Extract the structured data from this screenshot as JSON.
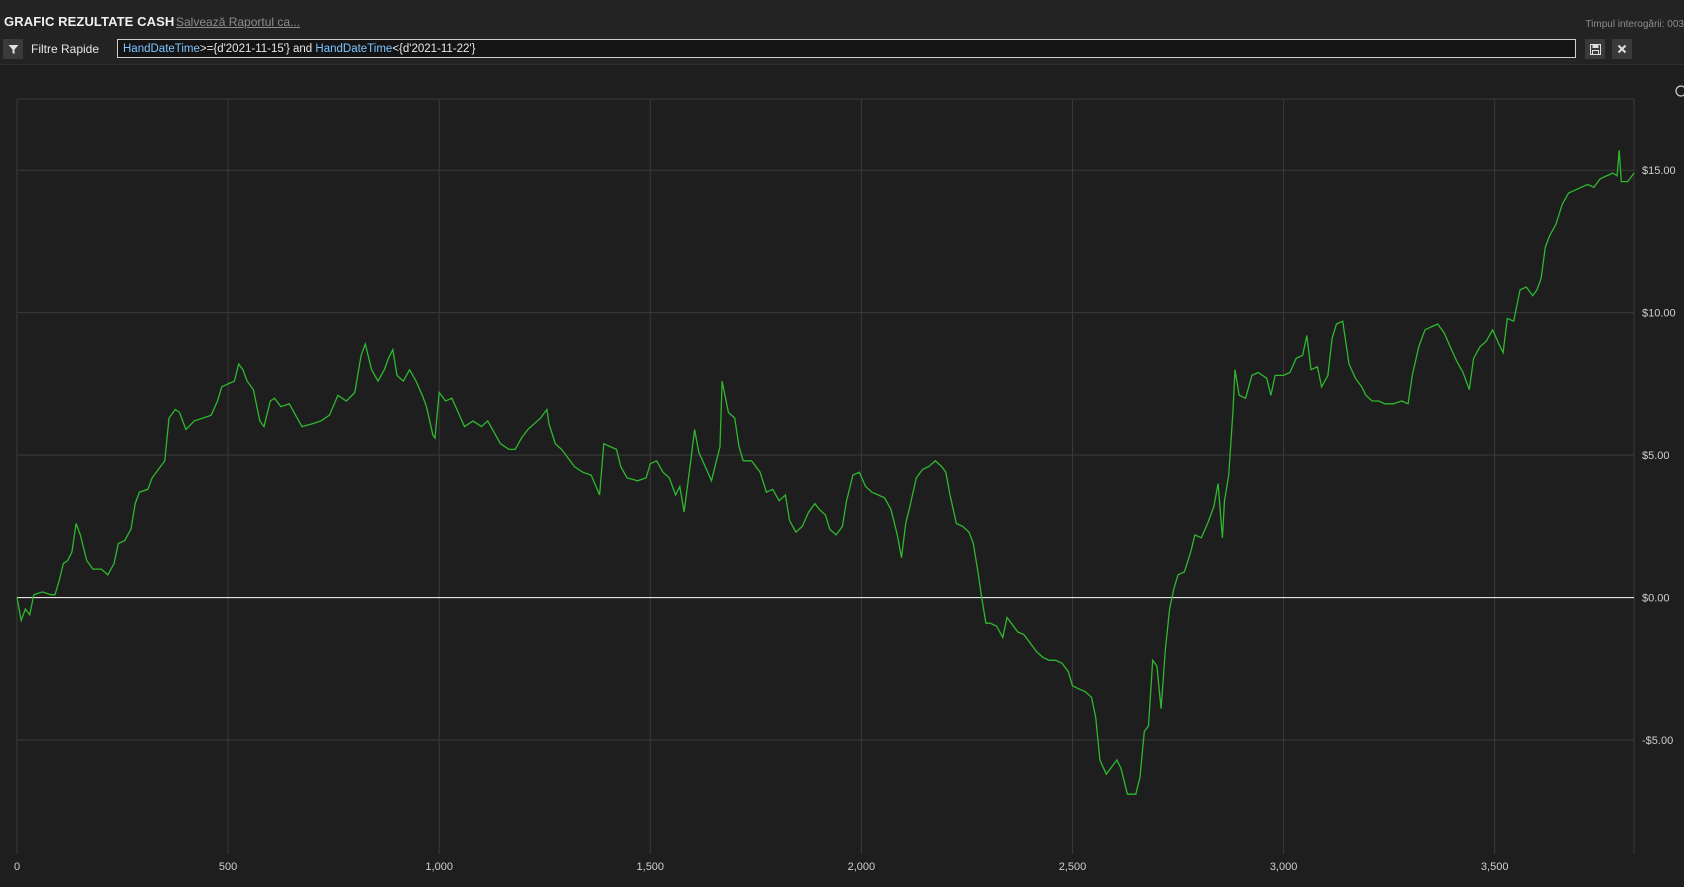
{
  "header": {
    "title": "GRAFIC REZULTATE CASH",
    "save_link": "Salvează Raportul ca...",
    "query_time": "Timpul interogării: 003"
  },
  "filter": {
    "label": "Filtre Rapide",
    "field1": "HandDateTime",
    "op1": ">=",
    "val1": "{d'2021-11-15'}",
    "conj": " and ",
    "field2": "HandDateTime",
    "op2": "<",
    "val2": "{d'2021-11-22'}"
  },
  "icons": {
    "filter": "filter-funnel-icon",
    "save": "floppy-save-icon",
    "close": "close-x-icon"
  },
  "colors": {
    "background": "#1e1e1e",
    "line": "#2db82d",
    "zero_line": "#ffffff",
    "grid": "#3a3a3a"
  },
  "chart_data": {
    "type": "line",
    "title": "",
    "xlabel": "",
    "ylabel": "",
    "xlim": [
      0,
      3830
    ],
    "ylim": [
      -9.0,
      17.5
    ],
    "x_ticks": [
      0,
      500,
      1000,
      1500,
      2000,
      2500,
      3000,
      3500
    ],
    "x_tick_labels": [
      "0",
      "500",
      "1,000",
      "1,500",
      "2,000",
      "2,500",
      "3,000",
      "3,500"
    ],
    "y_ticks": [
      -5,
      0,
      5,
      10,
      15
    ],
    "y_tick_labels": [
      "-$5.00",
      "$0.00",
      "$5.00",
      "$10.00",
      "$15.00"
    ],
    "grid": true,
    "zero_line": true,
    "series": [
      {
        "name": "",
        "points": [
          [
            0,
            0
          ],
          [
            10,
            -0.8
          ],
          [
            20,
            -0.4
          ],
          [
            30,
            -0.6
          ],
          [
            40,
            0.1
          ],
          [
            60,
            0.2
          ],
          [
            80,
            0.1
          ],
          [
            90,
            0.1
          ],
          [
            100,
            0.6
          ],
          [
            110,
            1.2
          ],
          [
            120,
            1.3
          ],
          [
            130,
            1.6
          ],
          [
            140,
            2.6
          ],
          [
            150,
            2.2
          ],
          [
            165,
            1.3
          ],
          [
            180,
            1.0
          ],
          [
            200,
            1.0
          ],
          [
            215,
            0.8
          ],
          [
            230,
            1.2
          ],
          [
            240,
            1.9
          ],
          [
            255,
            2.0
          ],
          [
            270,
            2.4
          ],
          [
            280,
            3.3
          ],
          [
            290,
            3.7
          ],
          [
            310,
            3.8
          ],
          [
            320,
            4.2
          ],
          [
            330,
            4.4
          ],
          [
            350,
            4.8
          ],
          [
            360,
            6.3
          ],
          [
            375,
            6.6
          ],
          [
            385,
            6.5
          ],
          [
            400,
            5.9
          ],
          [
            420,
            6.2
          ],
          [
            440,
            6.3
          ],
          [
            460,
            6.4
          ],
          [
            475,
            6.9
          ],
          [
            485,
            7.4
          ],
          [
            500,
            7.5
          ],
          [
            515,
            7.6
          ],
          [
            525,
            8.2
          ],
          [
            535,
            8.0
          ],
          [
            545,
            7.6
          ],
          [
            560,
            7.3
          ],
          [
            575,
            6.2
          ],
          [
            585,
            6.0
          ],
          [
            600,
            6.9
          ],
          [
            610,
            7.0
          ],
          [
            625,
            6.7
          ],
          [
            645,
            6.8
          ],
          [
            660,
            6.4
          ],
          [
            675,
            6.0
          ],
          [
            700,
            6.1
          ],
          [
            720,
            6.2
          ],
          [
            740,
            6.4
          ],
          [
            760,
            7.1
          ],
          [
            780,
            6.9
          ],
          [
            800,
            7.2
          ],
          [
            815,
            8.5
          ],
          [
            825,
            8.9
          ],
          [
            840,
            8.0
          ],
          [
            855,
            7.6
          ],
          [
            870,
            8.0
          ],
          [
            880,
            8.4
          ],
          [
            890,
            8.7
          ],
          [
            900,
            7.8
          ],
          [
            915,
            7.6
          ],
          [
            930,
            8.0
          ],
          [
            945,
            7.6
          ],
          [
            960,
            7.1
          ],
          [
            970,
            6.7
          ],
          [
            985,
            5.7
          ],
          [
            990,
            5.6
          ],
          [
            1000,
            7.2
          ],
          [
            1015,
            6.9
          ],
          [
            1030,
            7.0
          ],
          [
            1045,
            6.5
          ],
          [
            1060,
            6.0
          ],
          [
            1080,
            6.2
          ],
          [
            1100,
            6.0
          ],
          [
            1115,
            6.2
          ],
          [
            1130,
            5.8
          ],
          [
            1145,
            5.4
          ],
          [
            1165,
            5.2
          ],
          [
            1180,
            5.2
          ],
          [
            1195,
            5.6
          ],
          [
            1210,
            5.9
          ],
          [
            1225,
            6.1
          ],
          [
            1240,
            6.3
          ],
          [
            1255,
            6.6
          ],
          [
            1260,
            6.1
          ],
          [
            1275,
            5.4
          ],
          [
            1290,
            5.2
          ],
          [
            1300,
            5.0
          ],
          [
            1320,
            4.6
          ],
          [
            1340,
            4.4
          ],
          [
            1360,
            4.3
          ],
          [
            1380,
            3.6
          ],
          [
            1390,
            5.4
          ],
          [
            1405,
            5.3
          ],
          [
            1420,
            5.2
          ],
          [
            1430,
            4.6
          ],
          [
            1445,
            4.2
          ],
          [
            1470,
            4.1
          ],
          [
            1490,
            4.2
          ],
          [
            1500,
            4.7
          ],
          [
            1515,
            4.8
          ],
          [
            1530,
            4.4
          ],
          [
            1545,
            4.2
          ],
          [
            1560,
            3.6
          ],
          [
            1570,
            3.9
          ],
          [
            1580,
            3.0
          ],
          [
            1595,
            4.7
          ],
          [
            1605,
            5.9
          ],
          [
            1615,
            5.1
          ],
          [
            1630,
            4.6
          ],
          [
            1645,
            4.1
          ],
          [
            1655,
            4.7
          ],
          [
            1665,
            5.3
          ],
          [
            1670,
            7.6
          ],
          [
            1685,
            6.5
          ],
          [
            1700,
            6.3
          ],
          [
            1710,
            5.3
          ],
          [
            1720,
            4.8
          ],
          [
            1740,
            4.8
          ],
          [
            1760,
            4.4
          ],
          [
            1775,
            3.7
          ],
          [
            1790,
            3.8
          ],
          [
            1805,
            3.4
          ],
          [
            1820,
            3.6
          ],
          [
            1830,
            2.7
          ],
          [
            1845,
            2.3
          ],
          [
            1860,
            2.5
          ],
          [
            1875,
            3.0
          ],
          [
            1890,
            3.3
          ],
          [
            1900,
            3.1
          ],
          [
            1915,
            2.9
          ],
          [
            1925,
            2.4
          ],
          [
            1940,
            2.2
          ],
          [
            1955,
            2.5
          ],
          [
            1965,
            3.4
          ],
          [
            1980,
            4.3
          ],
          [
            1995,
            4.4
          ],
          [
            2010,
            3.9
          ],
          [
            2025,
            3.7
          ],
          [
            2040,
            3.6
          ],
          [
            2055,
            3.5
          ],
          [
            2070,
            3.1
          ],
          [
            2085,
            2.2
          ],
          [
            2095,
            1.4
          ],
          [
            2105,
            2.6
          ],
          [
            2115,
            3.2
          ],
          [
            2130,
            4.2
          ],
          [
            2145,
            4.5
          ],
          [
            2160,
            4.6
          ],
          [
            2175,
            4.8
          ],
          [
            2190,
            4.6
          ],
          [
            2200,
            4.4
          ],
          [
            2210,
            3.6
          ],
          [
            2225,
            2.6
          ],
          [
            2240,
            2.5
          ],
          [
            2255,
            2.3
          ],
          [
            2265,
            1.9
          ],
          [
            2275,
            1.0
          ],
          [
            2285,
            0.0
          ],
          [
            2295,
            -0.9
          ],
          [
            2305,
            -0.9
          ],
          [
            2320,
            -1.0
          ],
          [
            2335,
            -1.4
          ],
          [
            2345,
            -0.7
          ],
          [
            2355,
            -0.9
          ],
          [
            2370,
            -1.2
          ],
          [
            2385,
            -1.3
          ],
          [
            2400,
            -1.6
          ],
          [
            2415,
            -1.9
          ],
          [
            2430,
            -2.1
          ],
          [
            2445,
            -2.2
          ],
          [
            2460,
            -2.2
          ],
          [
            2475,
            -2.3
          ],
          [
            2490,
            -2.6
          ],
          [
            2500,
            -3.1
          ],
          [
            2515,
            -3.2
          ],
          [
            2530,
            -3.3
          ],
          [
            2545,
            -3.5
          ],
          [
            2555,
            -4.2
          ],
          [
            2565,
            -5.7
          ],
          [
            2580,
            -6.2
          ],
          [
            2595,
            -5.9
          ],
          [
            2605,
            -5.7
          ],
          [
            2615,
            -6.0
          ],
          [
            2630,
            -6.9
          ],
          [
            2650,
            -6.9
          ],
          [
            2660,
            -6.3
          ],
          [
            2670,
            -4.7
          ],
          [
            2680,
            -4.5
          ],
          [
            2690,
            -2.2
          ],
          [
            2700,
            -2.4
          ],
          [
            2710,
            -3.9
          ],
          [
            2720,
            -1.8
          ],
          [
            2730,
            -0.4
          ],
          [
            2740,
            0.3
          ],
          [
            2750,
            0.8
          ],
          [
            2765,
            0.9
          ],
          [
            2780,
            1.6
          ],
          [
            2790,
            2.2
          ],
          [
            2805,
            2.1
          ],
          [
            2820,
            2.6
          ],
          [
            2835,
            3.2
          ],
          [
            2845,
            4.0
          ],
          [
            2855,
            2.1
          ],
          [
            2860,
            3.4
          ],
          [
            2870,
            4.3
          ],
          [
            2880,
            6.5
          ],
          [
            2885,
            8.0
          ],
          [
            2895,
            7.1
          ],
          [
            2910,
            7.0
          ],
          [
            2925,
            7.8
          ],
          [
            2940,
            7.9
          ],
          [
            2960,
            7.7
          ],
          [
            2970,
            7.1
          ],
          [
            2980,
            7.8
          ],
          [
            3000,
            7.8
          ],
          [
            3015,
            7.9
          ],
          [
            3030,
            8.4
          ],
          [
            3045,
            8.5
          ],
          [
            3055,
            9.2
          ],
          [
            3065,
            8.0
          ],
          [
            3080,
            8.1
          ],
          [
            3090,
            7.4
          ],
          [
            3105,
            7.8
          ],
          [
            3115,
            9.1
          ],
          [
            3125,
            9.6
          ],
          [
            3140,
            9.7
          ],
          [
            3155,
            8.2
          ],
          [
            3170,
            7.7
          ],
          [
            3185,
            7.4
          ],
          [
            3195,
            7.1
          ],
          [
            3210,
            6.9
          ],
          [
            3225,
            6.9
          ],
          [
            3240,
            6.8
          ],
          [
            3260,
            6.8
          ],
          [
            3280,
            6.9
          ],
          [
            3295,
            6.8
          ],
          [
            3305,
            7.8
          ],
          [
            3320,
            8.8
          ],
          [
            3335,
            9.4
          ],
          [
            3350,
            9.5
          ],
          [
            3365,
            9.6
          ],
          [
            3380,
            9.3
          ],
          [
            3395,
            8.8
          ],
          [
            3410,
            8.3
          ],
          [
            3425,
            7.9
          ],
          [
            3440,
            7.3
          ],
          [
            3450,
            8.4
          ],
          [
            3465,
            8.8
          ],
          [
            3480,
            9.0
          ],
          [
            3495,
            9.4
          ],
          [
            3510,
            8.9
          ],
          [
            3520,
            8.6
          ],
          [
            3530,
            9.8
          ],
          [
            3545,
            9.7
          ],
          [
            3560,
            10.8
          ],
          [
            3575,
            10.9
          ],
          [
            3590,
            10.6
          ],
          [
            3600,
            10.8
          ],
          [
            3610,
            11.2
          ],
          [
            3620,
            12.3
          ],
          [
            3630,
            12.7
          ],
          [
            3645,
            13.1
          ],
          [
            3660,
            13.8
          ],
          [
            3675,
            14.2
          ],
          [
            3690,
            14.3
          ],
          [
            3705,
            14.4
          ],
          [
            3720,
            14.5
          ],
          [
            3735,
            14.4
          ],
          [
            3750,
            14.7
          ],
          [
            3765,
            14.8
          ],
          [
            3780,
            14.9
          ],
          [
            3790,
            14.8
          ],
          [
            3795,
            15.7
          ],
          [
            3800,
            14.6
          ],
          [
            3815,
            14.6
          ],
          [
            3830,
            14.9
          ]
        ]
      }
    ]
  }
}
